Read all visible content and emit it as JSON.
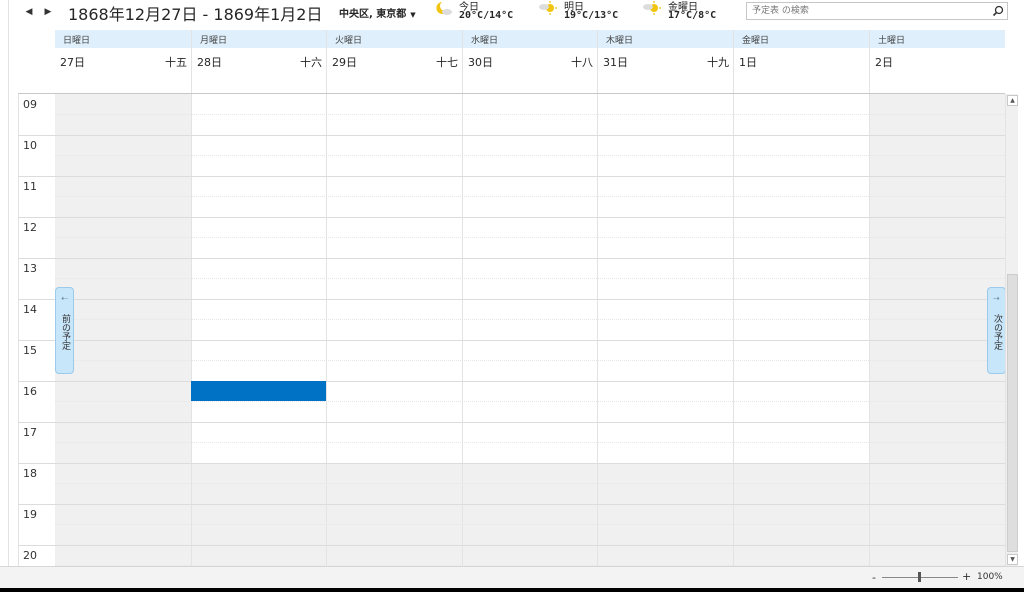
{
  "header": {
    "date_range": "1868年12月27日 - 1869年1月2日",
    "location": "中央区, 東京都",
    "prev_icon": "triangle-left-icon",
    "next_icon": "triangle-right-icon"
  },
  "weather": [
    {
      "label": "今日",
      "temp": "20°C/14°C",
      "icon": "moon-cloud-icon"
    },
    {
      "label": "明日",
      "temp": "19°C/13°C",
      "icon": "sun-cloud-icon"
    },
    {
      "label": "金曜日",
      "temp": "17°C/8°C",
      "icon": "sun-cloud-icon"
    }
  ],
  "search": {
    "placeholder": "予定表 の検索",
    "icon": "search-icon"
  },
  "days": [
    {
      "weekday": "日曜日",
      "date": "27日",
      "lunar": "十五",
      "weekend": true
    },
    {
      "weekday": "月曜日",
      "date": "28日",
      "lunar": "十六",
      "weekend": false
    },
    {
      "weekday": "火曜日",
      "date": "29日",
      "lunar": "十七",
      "weekend": false
    },
    {
      "weekday": "水曜日",
      "date": "30日",
      "lunar": "十八",
      "weekend": false
    },
    {
      "weekday": "木曜日",
      "date": "31日",
      "lunar": "十九",
      "weekend": false
    },
    {
      "weekday": "金曜日",
      "date": "1日",
      "lunar": "",
      "weekend": false
    },
    {
      "weekday": "土曜日",
      "date": "2日",
      "lunar": "",
      "weekend": true
    }
  ],
  "hours": [
    "09",
    "10",
    "11",
    "12",
    "13",
    "14",
    "15",
    "16",
    "17",
    "18",
    "19",
    "20"
  ],
  "work_hours": {
    "start": "09",
    "end": "18"
  },
  "event": {
    "day": "月曜日",
    "start": "16",
    "color": "#0072c6"
  },
  "side_tabs": {
    "prev_label": "前の予定",
    "next_label": "次の予定"
  },
  "status": {
    "zoom_level": "100%",
    "zoom_minus": "-",
    "zoom_plus": "+"
  },
  "colors": {
    "header_band": "#dff0fc",
    "offhours": "#f0f0f0",
    "accent": "#0072c6",
    "tab": "#c7e6fa"
  }
}
